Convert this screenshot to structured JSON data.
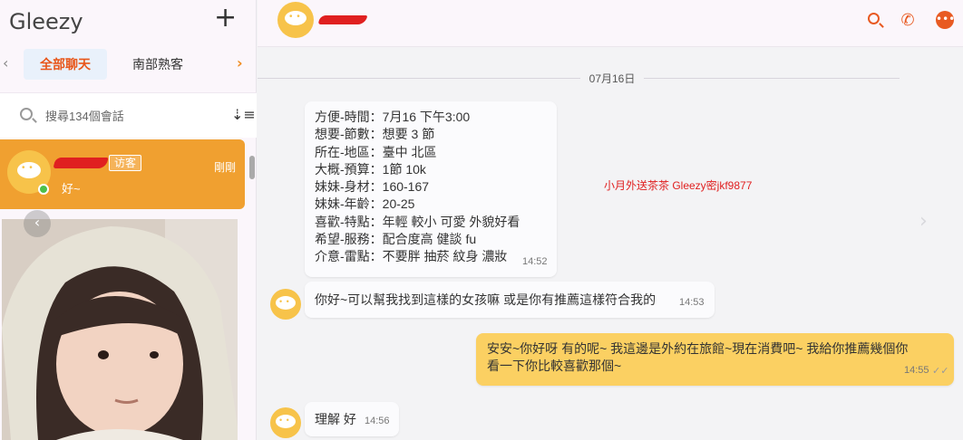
{
  "sidebar": {
    "app_title": "Gleezy",
    "add_label": "+",
    "tab_prev": "‹",
    "tab_next": "›",
    "tabs": [
      {
        "label": "全部聊天",
        "active": true
      },
      {
        "label": "南部熟客",
        "active": false
      }
    ],
    "search_placeholder": "搜尋134個會話",
    "sort_icon": "sort-icon",
    "chat_item": {
      "badge": "访客",
      "time": "剛剛",
      "preview": "好~",
      "status": "online"
    },
    "photo_prev": "‹"
  },
  "header": {
    "icons": [
      "search-icon",
      "phone-call-icon",
      "more-icon"
    ],
    "more_label": "•••"
  },
  "conversation": {
    "date": "07月16日",
    "messages": [
      {
        "direction": "in",
        "lines": [
          "方便-時間：7月16 下午3:00",
          "想要-節數：想要 3 節",
          "所在-地區：臺中 北區",
          "大概-預算：1節 10k",
          "妹妹-身材：160-167",
          "妹妹-年齡：20-25",
          "喜歡-特點：年輕 較小 可愛 外貌好看",
          "希望-服務：配合度高 健談 fu",
          "介意-雷點：不要胖 抽菸 紋身 濃妝"
        ],
        "time": "14:52"
      },
      {
        "direction": "in",
        "text": "你好~可以幫我找到這樣的女孩嘛 或是你有推薦這樣符合我的",
        "time": "14:53"
      },
      {
        "direction": "out",
        "lines": [
          "安安~你好呀 有的呢~ 我這邊是外約在旅館~現在消費吧~ 我給你推薦幾個你",
          "看一下你比較喜歡那個~"
        ],
        "time": "14:55",
        "read_mark": "✓✓"
      },
      {
        "direction": "in",
        "text": "理解 好",
        "time": "14:56"
      }
    ],
    "watermark": "小月外送茶茶 Gleezy密jkf9877",
    "next_arrow": "›"
  },
  "colors": {
    "accent": "#e85a22",
    "active_chat": "#f0a030",
    "outgoing_bubble": "#fbd062",
    "avatar": "#f7c34a",
    "online": "#4cc04a"
  }
}
